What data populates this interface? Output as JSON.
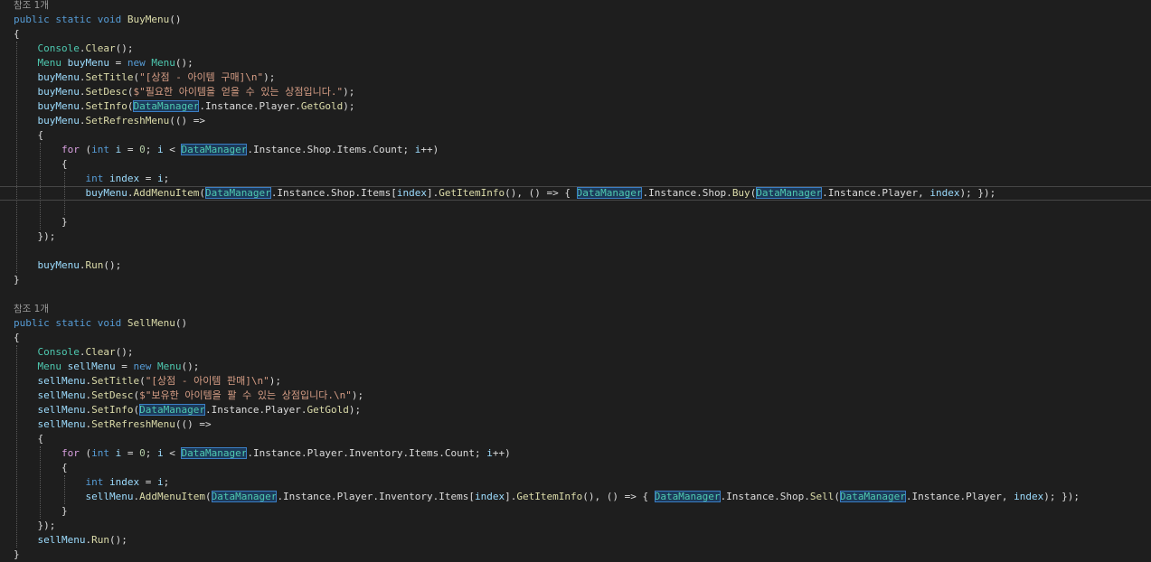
{
  "colors": {
    "background": "#1e1e1e",
    "keyword": "#569cd6",
    "control_keyword": "#d8a0df",
    "type": "#4ec9b0",
    "method": "#dcdcaa",
    "variable": "#9cdcfe",
    "string": "#d69d85",
    "number": "#b5cea8",
    "highlight": "#1c3a5a"
  },
  "lines": [
    {
      "lens": "참조 1개"
    },
    {
      "tokens": [
        [
          "kw",
          "public"
        ],
        [
          "pl",
          " "
        ],
        [
          "kw",
          "static"
        ],
        [
          "pl",
          " "
        ],
        [
          "kw",
          "void"
        ],
        [
          "pl",
          " "
        ],
        [
          "mt",
          "BuyMenu"
        ],
        [
          "pl",
          "()"
        ]
      ]
    },
    {
      "tokens": [
        [
          "pl",
          "{"
        ]
      ]
    },
    {
      "tokens": [
        [
          "pl",
          "    "
        ],
        [
          "ty",
          "Console"
        ],
        [
          "pl",
          "."
        ],
        [
          "mt",
          "Clear"
        ],
        [
          "pl",
          "();"
        ]
      ]
    },
    {
      "tokens": [
        [
          "pl",
          "    "
        ],
        [
          "ty",
          "Menu"
        ],
        [
          "pl",
          " "
        ],
        [
          "va",
          "buyMenu"
        ],
        [
          "pl",
          " = "
        ],
        [
          "kw",
          "new"
        ],
        [
          "pl",
          " "
        ],
        [
          "ty",
          "Menu"
        ],
        [
          "pl",
          "();"
        ]
      ]
    },
    {
      "tokens": [
        [
          "pl",
          "    "
        ],
        [
          "va",
          "buyMenu"
        ],
        [
          "pl",
          "."
        ],
        [
          "mt",
          "SetTitle"
        ],
        [
          "pl",
          "("
        ],
        [
          "st",
          "\"[상점 - 아이템 구매]\\n\""
        ],
        [
          "pl",
          ");"
        ]
      ]
    },
    {
      "tokens": [
        [
          "pl",
          "    "
        ],
        [
          "va",
          "buyMenu"
        ],
        [
          "pl",
          "."
        ],
        [
          "mt",
          "SetDesc"
        ],
        [
          "pl",
          "("
        ],
        [
          "st",
          "$\"필요한 아이템을 얻을 수 있는 상점입니다.\""
        ],
        [
          "pl",
          ");"
        ]
      ]
    },
    {
      "tokens": [
        [
          "pl",
          "    "
        ],
        [
          "va",
          "buyMenu"
        ],
        [
          "pl",
          "."
        ],
        [
          "mt",
          "SetInfo"
        ],
        [
          "pl",
          "("
        ],
        [
          "hl",
          "DataManager"
        ],
        [
          "pl",
          ".Instance.Player."
        ],
        [
          "mt",
          "GetGold"
        ],
        [
          "pl",
          ");"
        ]
      ]
    },
    {
      "tokens": [
        [
          "pl",
          "    "
        ],
        [
          "va",
          "buyMenu"
        ],
        [
          "pl",
          "."
        ],
        [
          "mt",
          "SetRefreshMenu"
        ],
        [
          "pl",
          "(() =>"
        ]
      ]
    },
    {
      "tokens": [
        [
          "pl",
          "    {"
        ]
      ]
    },
    {
      "tokens": [
        [
          "pl",
          "        "
        ],
        [
          "kwc",
          "for"
        ],
        [
          "pl",
          " ("
        ],
        [
          "kw",
          "int"
        ],
        [
          "pl",
          " "
        ],
        [
          "va",
          "i"
        ],
        [
          "pl",
          " = "
        ],
        [
          "nm",
          "0"
        ],
        [
          "pl",
          "; "
        ],
        [
          "va",
          "i"
        ],
        [
          "pl",
          " < "
        ],
        [
          "hl",
          "DataManager"
        ],
        [
          "pl",
          ".Instance.Shop.Items.Count; "
        ],
        [
          "va",
          "i"
        ],
        [
          "pl",
          "++)"
        ]
      ]
    },
    {
      "tokens": [
        [
          "pl",
          "        {"
        ]
      ]
    },
    {
      "tokens": [
        [
          "pl",
          "            "
        ],
        [
          "kw",
          "int"
        ],
        [
          "pl",
          " "
        ],
        [
          "va",
          "index"
        ],
        [
          "pl",
          " = "
        ],
        [
          "va",
          "i"
        ],
        [
          "pl",
          ";"
        ]
      ]
    },
    {
      "current": true,
      "tokens": [
        [
          "pl",
          "            "
        ],
        [
          "va",
          "buyMenu"
        ],
        [
          "pl",
          "."
        ],
        [
          "mt",
          "AddMenuItem"
        ],
        [
          "pl",
          "("
        ],
        [
          "hl",
          "DataManager"
        ],
        [
          "pl",
          ".Instance.Shop.Items["
        ],
        [
          "va",
          "index"
        ],
        [
          "pl",
          "]."
        ],
        [
          "mt",
          "GetItemInfo"
        ],
        [
          "pl",
          "(), () => { "
        ],
        [
          "hl",
          "DataManager"
        ],
        [
          "pl",
          ".Instance.Shop."
        ],
        [
          "mt",
          "Buy"
        ],
        [
          "pl",
          "("
        ],
        [
          "hl",
          "DataManager"
        ],
        [
          "pl",
          ".Instance.Player, "
        ],
        [
          "va",
          "index"
        ],
        [
          "pl",
          "); });"
        ]
      ]
    },
    {
      "tokens": [
        [
          "pl",
          ""
        ]
      ]
    },
    {
      "tokens": [
        [
          "pl",
          "        }"
        ]
      ]
    },
    {
      "tokens": [
        [
          "pl",
          "    });"
        ]
      ]
    },
    {
      "tokens": [
        [
          "pl",
          ""
        ]
      ]
    },
    {
      "tokens": [
        [
          "pl",
          "    "
        ],
        [
          "va",
          "buyMenu"
        ],
        [
          "pl",
          "."
        ],
        [
          "mt",
          "Run"
        ],
        [
          "pl",
          "();"
        ]
      ]
    },
    {
      "tokens": [
        [
          "pl",
          "}"
        ]
      ]
    },
    {
      "tokens": [
        [
          "pl",
          ""
        ]
      ]
    },
    {
      "lens": "참조 1개"
    },
    {
      "tokens": [
        [
          "kw",
          "public"
        ],
        [
          "pl",
          " "
        ],
        [
          "kw",
          "static"
        ],
        [
          "pl",
          " "
        ],
        [
          "kw",
          "void"
        ],
        [
          "pl",
          " "
        ],
        [
          "mt",
          "SellMenu"
        ],
        [
          "pl",
          "()"
        ]
      ]
    },
    {
      "tokens": [
        [
          "pl",
          "{"
        ]
      ]
    },
    {
      "tokens": [
        [
          "pl",
          "    "
        ],
        [
          "ty",
          "Console"
        ],
        [
          "pl",
          "."
        ],
        [
          "mt",
          "Clear"
        ],
        [
          "pl",
          "();"
        ]
      ]
    },
    {
      "tokens": [
        [
          "pl",
          "    "
        ],
        [
          "ty",
          "Menu"
        ],
        [
          "pl",
          " "
        ],
        [
          "va",
          "sellMenu"
        ],
        [
          "pl",
          " = "
        ],
        [
          "kw",
          "new"
        ],
        [
          "pl",
          " "
        ],
        [
          "ty",
          "Menu"
        ],
        [
          "pl",
          "();"
        ]
      ]
    },
    {
      "tokens": [
        [
          "pl",
          "    "
        ],
        [
          "va",
          "sellMenu"
        ],
        [
          "pl",
          "."
        ],
        [
          "mt",
          "SetTitle"
        ],
        [
          "pl",
          "("
        ],
        [
          "st",
          "\"[상점 - 아이템 판매]\\n\""
        ],
        [
          "pl",
          ");"
        ]
      ]
    },
    {
      "tokens": [
        [
          "pl",
          "    "
        ],
        [
          "va",
          "sellMenu"
        ],
        [
          "pl",
          "."
        ],
        [
          "mt",
          "SetDesc"
        ],
        [
          "pl",
          "("
        ],
        [
          "st",
          "$\"보유한 아이템을 팔 수 있는 상점입니다.\\n\""
        ],
        [
          "pl",
          ");"
        ]
      ]
    },
    {
      "tokens": [
        [
          "pl",
          "    "
        ],
        [
          "va",
          "sellMenu"
        ],
        [
          "pl",
          "."
        ],
        [
          "mt",
          "SetInfo"
        ],
        [
          "pl",
          "("
        ],
        [
          "hl",
          "DataManager"
        ],
        [
          "pl",
          ".Instance.Player."
        ],
        [
          "mt",
          "GetGold"
        ],
        [
          "pl",
          ");"
        ]
      ]
    },
    {
      "tokens": [
        [
          "pl",
          "    "
        ],
        [
          "va",
          "sellMenu"
        ],
        [
          "pl",
          "."
        ],
        [
          "mt",
          "SetRefreshMenu"
        ],
        [
          "pl",
          "(() =>"
        ]
      ]
    },
    {
      "tokens": [
        [
          "pl",
          "    {"
        ]
      ]
    },
    {
      "tokens": [
        [
          "pl",
          "        "
        ],
        [
          "kwc",
          "for"
        ],
        [
          "pl",
          " ("
        ],
        [
          "kw",
          "int"
        ],
        [
          "pl",
          " "
        ],
        [
          "va",
          "i"
        ],
        [
          "pl",
          " = "
        ],
        [
          "nm",
          "0"
        ],
        [
          "pl",
          "; "
        ],
        [
          "va",
          "i"
        ],
        [
          "pl",
          " < "
        ],
        [
          "hl",
          "DataManager"
        ],
        [
          "pl",
          ".Instance.Player.Inventory.Items.Count; "
        ],
        [
          "va",
          "i"
        ],
        [
          "pl",
          "++)"
        ]
      ]
    },
    {
      "tokens": [
        [
          "pl",
          "        {"
        ]
      ]
    },
    {
      "tokens": [
        [
          "pl",
          "            "
        ],
        [
          "kw",
          "int"
        ],
        [
          "pl",
          " "
        ],
        [
          "va",
          "index"
        ],
        [
          "pl",
          " = "
        ],
        [
          "va",
          "i"
        ],
        [
          "pl",
          ";"
        ]
      ]
    },
    {
      "tokens": [
        [
          "pl",
          "            "
        ],
        [
          "va",
          "sellMenu"
        ],
        [
          "pl",
          "."
        ],
        [
          "mt",
          "AddMenuItem"
        ],
        [
          "pl",
          "("
        ],
        [
          "hl",
          "DataManager"
        ],
        [
          "pl",
          ".Instance.Player.Inventory.Items["
        ],
        [
          "va",
          "index"
        ],
        [
          "pl",
          "]."
        ],
        [
          "mt",
          "GetItemInfo"
        ],
        [
          "pl",
          "(), () => { "
        ],
        [
          "hl",
          "DataManager"
        ],
        [
          "pl",
          ".Instance.Shop."
        ],
        [
          "mt",
          "Sell"
        ],
        [
          "pl",
          "("
        ],
        [
          "hl",
          "DataManager"
        ],
        [
          "pl",
          ".Instance.Player, "
        ],
        [
          "va",
          "index"
        ],
        [
          "pl",
          "); });"
        ]
      ]
    },
    {
      "tokens": [
        [
          "pl",
          "        }"
        ]
      ]
    },
    {
      "tokens": [
        [
          "pl",
          "    });"
        ]
      ]
    },
    {
      "tokens": [
        [
          "pl",
          "    "
        ],
        [
          "va",
          "sellMenu"
        ],
        [
          "pl",
          "."
        ],
        [
          "mt",
          "Run"
        ],
        [
          "pl",
          "();"
        ]
      ]
    },
    {
      "tokens": [
        [
          "pl",
          "}"
        ]
      ]
    }
  ]
}
